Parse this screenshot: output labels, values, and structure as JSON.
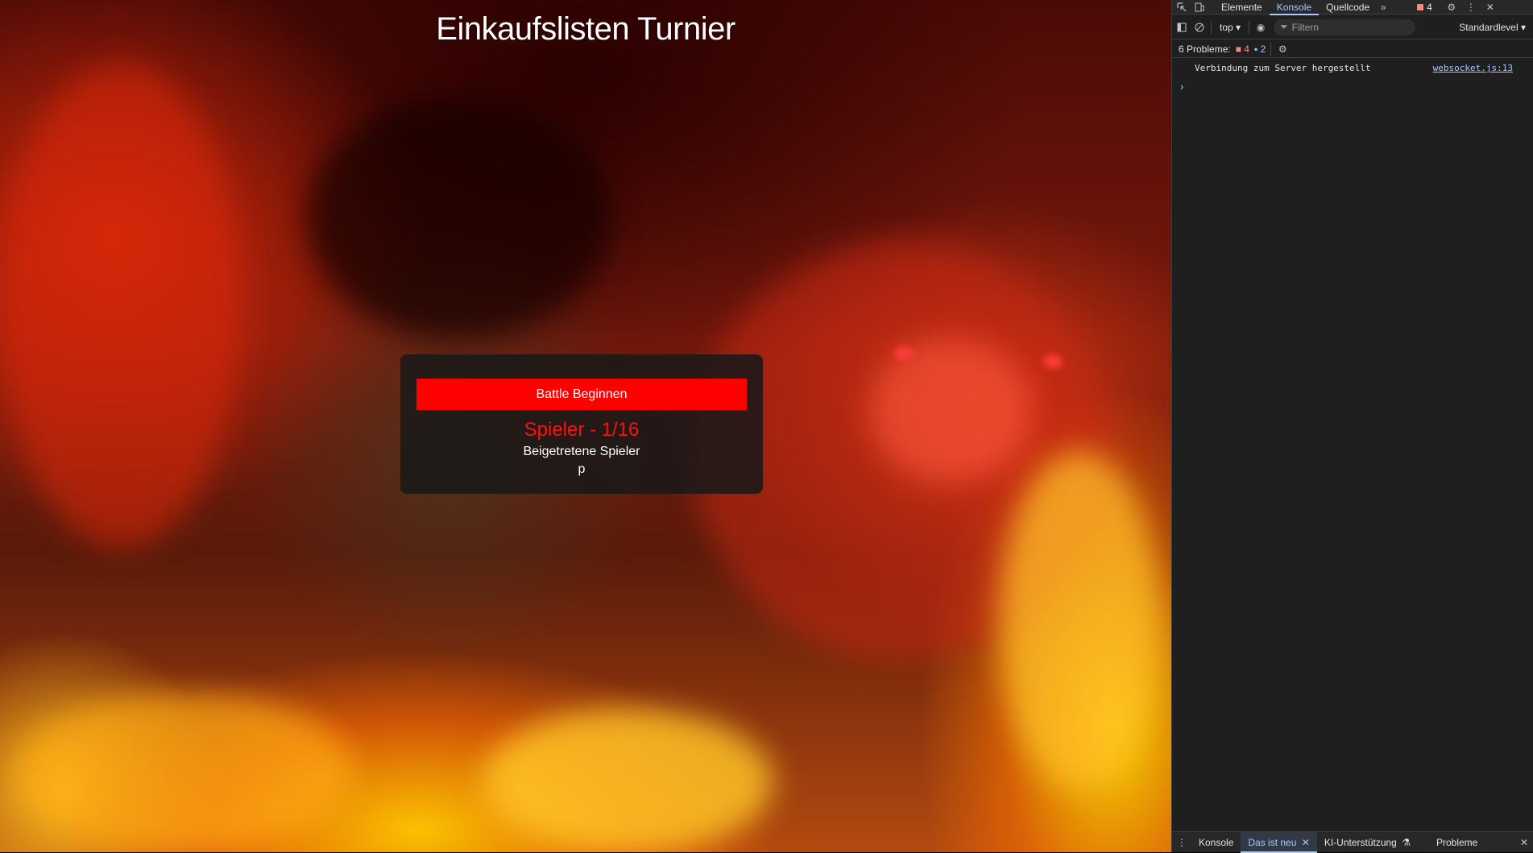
{
  "page": {
    "title": "Einkaufslisten Turnier",
    "lobby": {
      "start_button": "Battle Beginnen",
      "player_count": "Spieler - 1/16",
      "joined_label": "Beigetretene Spieler",
      "players": [
        "p"
      ]
    }
  },
  "devtools": {
    "tabs": [
      "Elemente",
      "Konsole",
      "Quellcode"
    ],
    "active_tab": "Konsole",
    "error_count": "4",
    "toolbar": {
      "context": "top",
      "filter_placeholder": "Filtern",
      "level": "Standardlevel"
    },
    "issues": {
      "label": "6 Probleme:",
      "errors": "4",
      "infos": "2"
    },
    "console": {
      "message": "Verbindung zum Server hergestellt",
      "source": "websocket.js:13"
    },
    "drawer_tabs": [
      "Konsole",
      "Das ist neu",
      "KI-Unterstützung",
      "Probleme"
    ],
    "drawer_active": "Das ist neu"
  },
  "colors": {
    "button_red": "#ff0000",
    "player_count_red": "#ff0f0f",
    "devtools_accent": "#a8c7fa"
  }
}
